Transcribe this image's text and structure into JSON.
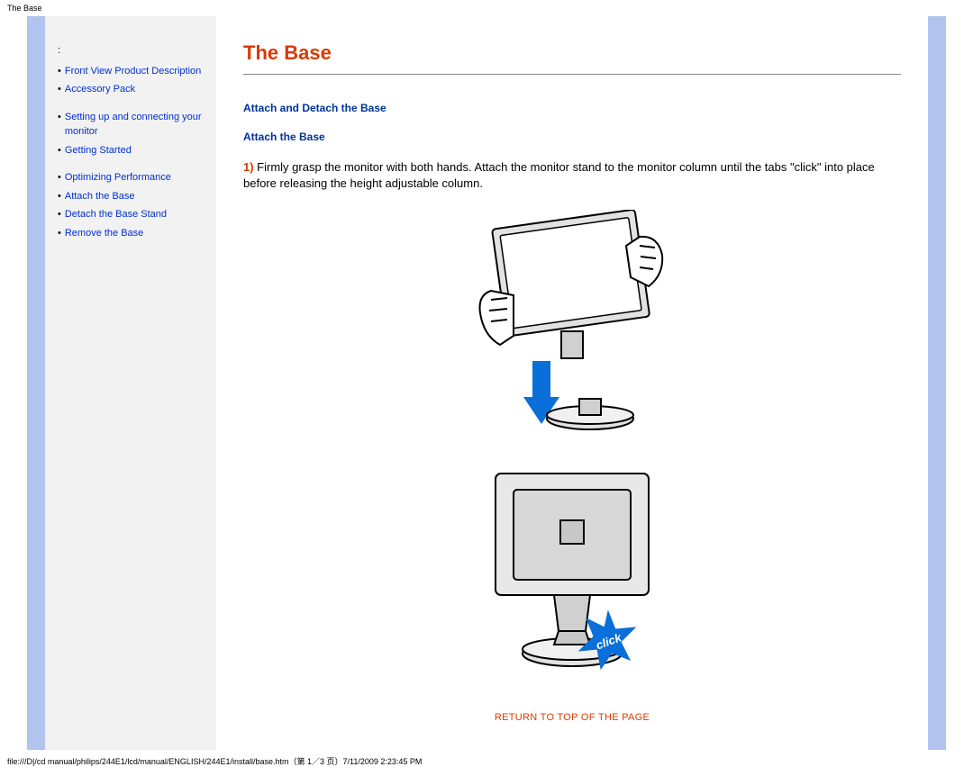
{
  "header": {
    "pathTitle": "The Base"
  },
  "sidebar": {
    "items": [
      {
        "label": "Front View Product Description"
      },
      {
        "label": "Accessory Pack"
      },
      {
        "label": "Setting up and connecting your monitor"
      },
      {
        "label": "Getting Started"
      },
      {
        "label": "Optimizing Performance"
      },
      {
        "label": "Attach the Base"
      },
      {
        "label": "Detach the Base Stand"
      },
      {
        "label": "Remove the Base"
      }
    ]
  },
  "content": {
    "title": "The Base",
    "section1": "Attach and Detach the Base",
    "section2": "Attach the Base",
    "stepNum": "1)",
    "stepText": " Firmly grasp the monitor with both hands. Attach the monitor stand to the monitor column until the tabs \"click\" into place before releasing the height adjustable column.",
    "returnLink": "RETURN TO TOP OF THE PAGE",
    "clickBadge": "click"
  },
  "footer": {
    "path": "file:///D|/cd manual/philips/244E1/lcd/manual/ENGLISH/244E1/install/base.htm（第 1／3 页）7/11/2009 2:23:45 PM"
  }
}
